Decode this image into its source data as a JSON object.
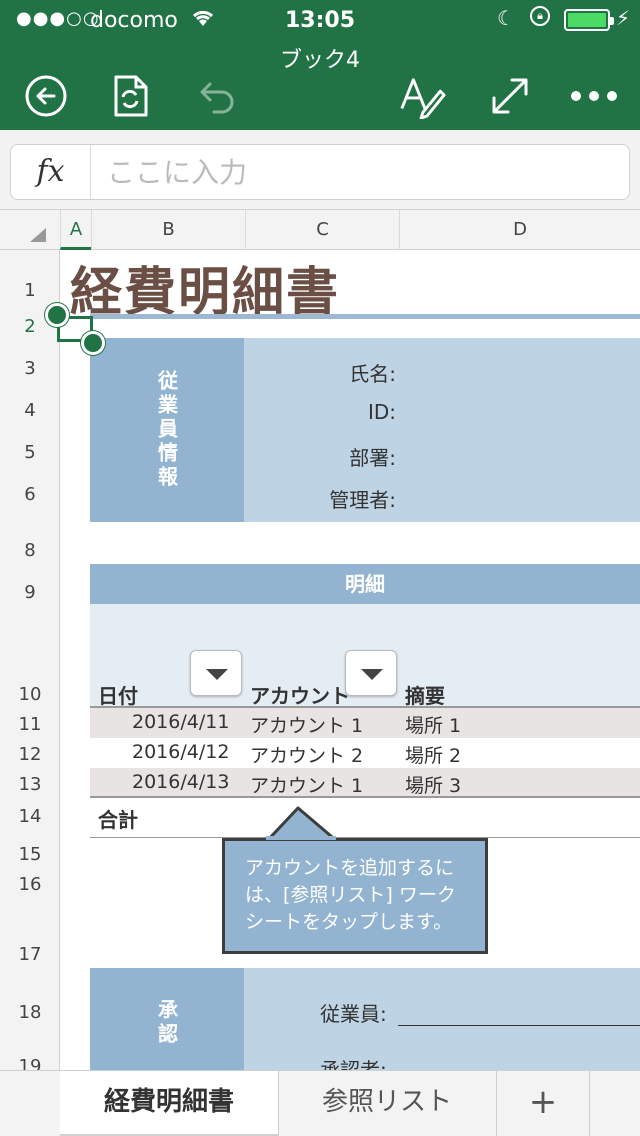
{
  "status_bar": {
    "signal": "●●●○○",
    "carrier": "docomo",
    "time": "13:05"
  },
  "header": {
    "title": "ブック4",
    "bg_color": "#217346"
  },
  "formula_bar": {
    "fx_label": "fx",
    "placeholder": "ここに入力"
  },
  "columns": [
    "A",
    "B",
    "C",
    "D"
  ],
  "rows": [
    "1",
    "2",
    "3",
    "4",
    "5",
    "6",
    "8",
    "9",
    "10",
    "11",
    "12",
    "13",
    "14",
    "15",
    "16",
    "17",
    "18",
    "19"
  ],
  "sheet": {
    "title": "経費明細書",
    "employee_section": {
      "label": "従業員情報",
      "fields": [
        "氏名:",
        "ID:",
        "部署:",
        "管理者:"
      ]
    },
    "detail_section": {
      "header": "明細",
      "columns": [
        "日付",
        "アカウント",
        "摘要"
      ],
      "rows": [
        {
          "date": "2016/4/11",
          "account": "アカウント 1",
          "desc": "場所 1"
        },
        {
          "date": "2016/4/12",
          "account": "アカウント 2",
          "desc": "場所 2"
        },
        {
          "date": "2016/4/13",
          "account": "アカウント 1",
          "desc": "場所 3"
        }
      ],
      "total_label": "合計"
    },
    "approval_section": {
      "label": "承認",
      "fields": [
        "従業員:",
        "承認者:"
      ]
    }
  },
  "tooltip": {
    "lines": [
      "アカウントを追加するに",
      "は、[参照リスト] ワーク",
      "シートをタップします。"
    ]
  },
  "tabs": [
    {
      "label": "経費明細書",
      "active": true
    },
    {
      "label": "参照リスト",
      "active": false
    },
    {
      "label": "+",
      "active": false
    }
  ]
}
